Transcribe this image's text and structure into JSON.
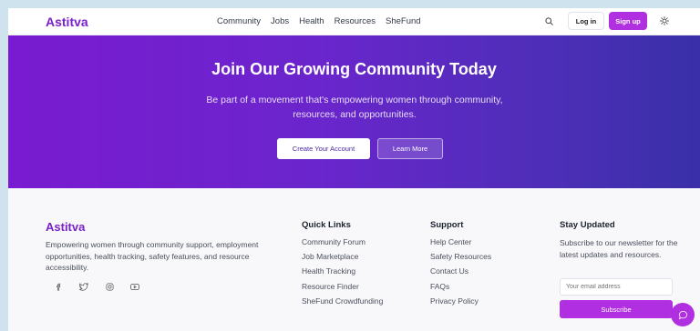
{
  "header": {
    "logo": "Astitva",
    "nav": [
      "Community",
      "Jobs",
      "Health",
      "Resources",
      "SheFund"
    ],
    "login_label": "Log in",
    "signup_label": "Sign up"
  },
  "hero": {
    "title": "Join Our Growing Community Today",
    "subtitle": "Be part of a movement that's empowering women through community, resources, and opportunities.",
    "create_label": "Create Your Account",
    "learn_label": "Learn More"
  },
  "footer": {
    "brand": "Astitva",
    "description": "Empowering women through community support, employment opportunities, health tracking, safety features, and resource accessibility.",
    "quick_links": {
      "title": "Quick Links",
      "items": [
        "Community Forum",
        "Job Marketplace",
        "Health Tracking",
        "Resource Finder",
        "SheFund Crowdfunding"
      ]
    },
    "support": {
      "title": "Support",
      "items": [
        "Help Center",
        "Safety Resources",
        "Contact Us",
        "FAQs",
        "Privacy Policy"
      ]
    },
    "newsletter": {
      "title": "Stay Updated",
      "text": "Subscribe to our newsletter for the latest updates and resources.",
      "placeholder": "Your email address",
      "button_label": "Subscribe"
    },
    "socials": [
      "facebook-icon",
      "twitter-icon",
      "instagram-icon",
      "youtube-icon"
    ]
  },
  "colors": {
    "brand": "#7a22c9",
    "accent": "#b02fe0",
    "hero_start": "#7a1bd1",
    "hero_end": "#3a2fa8"
  }
}
